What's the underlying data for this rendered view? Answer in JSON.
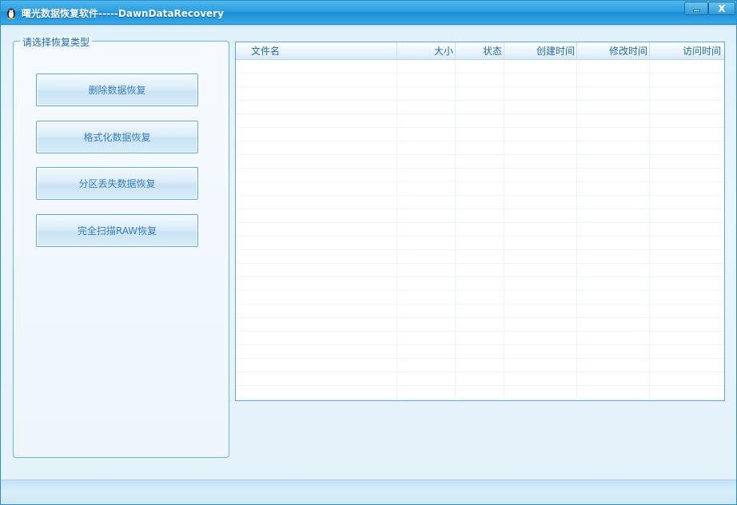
{
  "window": {
    "title": "曙光数据恢复软件-----DawnDataRecovery",
    "icon": "penguin-icon",
    "minimize_label": "",
    "close_label": "X",
    "accent_color": "#2e9fe0"
  },
  "sidebar": {
    "legend": "请选择恢复类型",
    "buttons": [
      {
        "label": "删除数据恢复"
      },
      {
        "label": "格式化数据恢复"
      },
      {
        "label": "分区丢失数据恢复"
      },
      {
        "label": "完全扫描RAW恢复"
      }
    ]
  },
  "file_list": {
    "columns": [
      "文件名",
      "大小",
      "状态",
      "创建时间",
      "修改时间",
      "访问时间"
    ],
    "rows": []
  },
  "statusbar": {
    "text": ""
  }
}
